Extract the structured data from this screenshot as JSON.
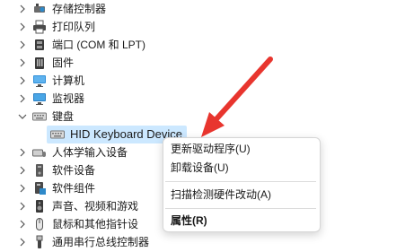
{
  "tree": {
    "items": [
      {
        "label": "存储控制器",
        "icon": "storage-controller-icon",
        "expanded": false
      },
      {
        "label": "打印队列",
        "icon": "printer-icon",
        "expanded": false
      },
      {
        "label": "端口 (COM 和 LPT)",
        "icon": "port-icon",
        "expanded": false
      },
      {
        "label": "固件",
        "icon": "firmware-icon",
        "expanded": false
      },
      {
        "label": "计算机",
        "icon": "computer-icon",
        "expanded": false
      },
      {
        "label": "监视器",
        "icon": "monitor-icon",
        "expanded": false
      },
      {
        "label": "键盘",
        "icon": "keyboard-icon",
        "expanded": true
      },
      {
        "label": "HID Keyboard Device",
        "icon": "keyboard-icon",
        "selected": true
      },
      {
        "label": "人体学输入设备",
        "icon": "hid-icon",
        "expanded": false
      },
      {
        "label": "软件设备",
        "icon": "software-device-icon",
        "expanded": false
      },
      {
        "label": "软件组件",
        "icon": "software-component-icon",
        "expanded": false
      },
      {
        "label": "声音、视频和游戏",
        "icon": "speaker-icon",
        "expanded": false
      },
      {
        "label": "鼠标和其他指针设",
        "icon": "mouse-icon",
        "expanded": false
      },
      {
        "label": "通用串行总线控制器",
        "icon": "usb-icon",
        "expanded": false
      }
    ]
  },
  "context_menu": {
    "items": [
      {
        "label": "更新驱动程序(U)"
      },
      {
        "label": "卸载设备(U)"
      },
      {
        "label": "扫描检测硬件改动(A)"
      },
      {
        "label": "属性(R)",
        "bold": true
      }
    ]
  },
  "colors": {
    "selection": "#cce8ff",
    "arrow": "#e8352e"
  }
}
